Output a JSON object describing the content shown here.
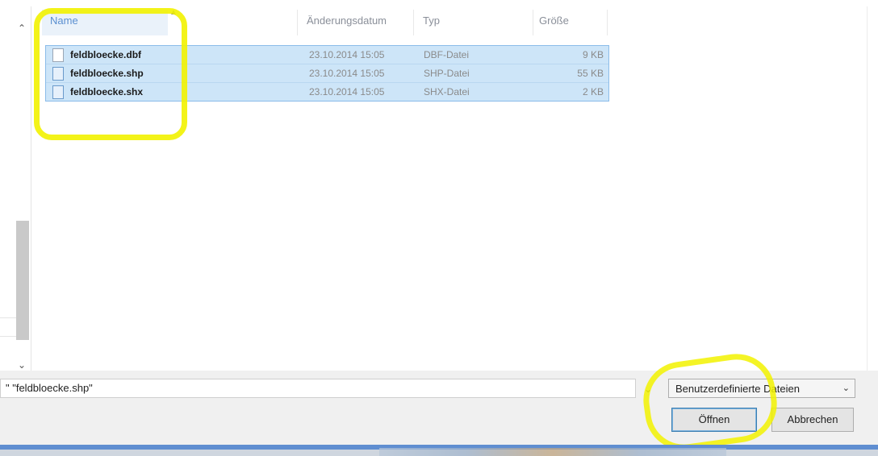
{
  "columns": {
    "name": "Name",
    "date": "Änderungsdatum",
    "type": "Typ",
    "size": "Größe"
  },
  "files": [
    {
      "name": "feldbloecke.dbf",
      "date": "23.10.2014 15:05",
      "type": "DBF-Datei",
      "size": "9 KB",
      "icon": "blank-file-icon"
    },
    {
      "name": "feldbloecke.shp",
      "date": "23.10.2014 15:05",
      "type": "SHP-Datei",
      "size": "55 KB",
      "icon": "document-file-icon"
    },
    {
      "name": "feldbloecke.shx",
      "date": "23.10.2014 15:05",
      "type": "SHX-Datei",
      "size": "2 KB",
      "icon": "document-file-icon"
    }
  ],
  "filename_field": {
    "value": "\" \"feldbloecke.shp\""
  },
  "filetype_select": {
    "value": "Benutzerdefinierte Dateien"
  },
  "buttons": {
    "open": "Öffnen",
    "cancel": "Abbrechen"
  },
  "colors": {
    "selection": "#cde5f8",
    "highlight_marker": "#f2f200",
    "accent": "#5f8ed1"
  }
}
